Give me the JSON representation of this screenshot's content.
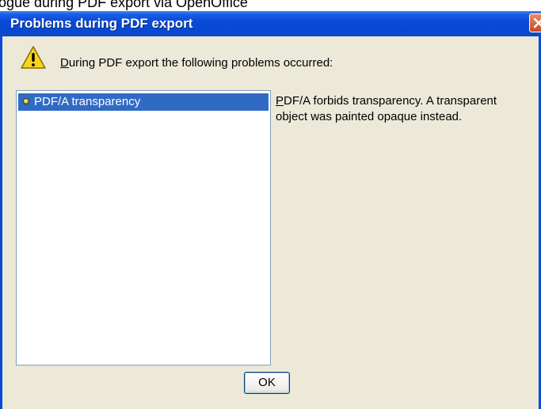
{
  "caption": "ogue during PDF export via OpenOffice",
  "window": {
    "title": "Problems during PDF export",
    "close_icon": "close-icon"
  },
  "message": {
    "icon": "warning-icon",
    "mnemonic": "D",
    "text_rest": "uring PDF export the following problems occurred:"
  },
  "problems": {
    "items": [
      {
        "label": "PDF/A transparency",
        "selected": true
      }
    ]
  },
  "description": {
    "mnemonic": "P",
    "text_rest": "DF/A forbids transparency. A transparent object was painted opaque instead."
  },
  "buttons": {
    "ok_label": "OK"
  },
  "colors": {
    "titlebar": "#0a4ad8",
    "selection": "#316ac5",
    "dialog_bg": "#ece9d8"
  }
}
